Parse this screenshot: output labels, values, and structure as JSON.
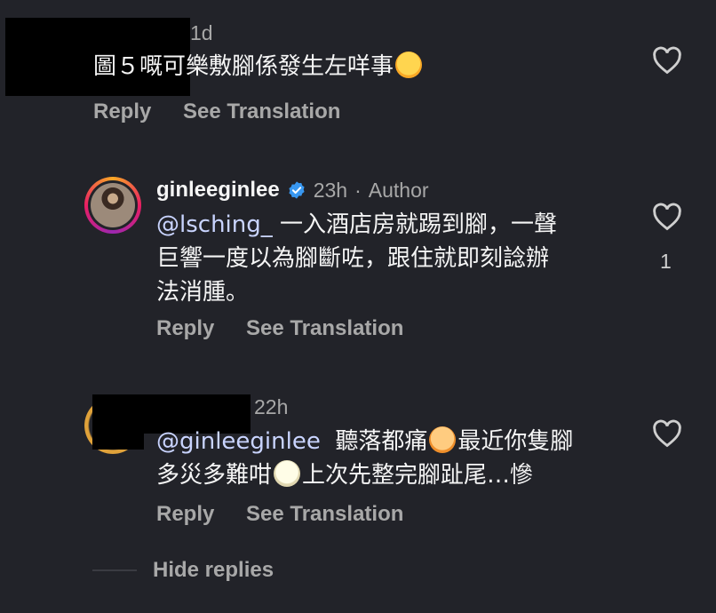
{
  "comments": [
    {
      "time": "1d",
      "text": "圖５嘅可樂敷腳係發生左咩事",
      "emoji": "face-with-tears-of-joy",
      "reply_label": "Reply",
      "translate_label": "See Translation"
    },
    {
      "username": "ginleeginlee",
      "verified": true,
      "time": "23h",
      "author_badge": "Author",
      "mention": "@lsching_",
      "line1": "一入酒店房就踢到腳，一聲",
      "line2": "巨響一度以為腳斷咗，跟住就即刻諗辦",
      "line3": "法消腫。",
      "likes": "1",
      "reply_label": "Reply",
      "translate_label": "See Translation"
    },
    {
      "time": "22h",
      "mention": "@ginleeginlee",
      "line1_a": "聽落都痛",
      "line1_b": "最近你隻腳",
      "line2_a": "多災多難咁",
      "line2_b": "上次先整完腳趾尾…慘",
      "emoji1": "face-screaming-in-fear",
      "emoji2": "cold-face",
      "reply_label": "Reply",
      "translate_label": "See Translation"
    }
  ],
  "hide_replies_label": "Hide replies",
  "separator": "·",
  "colors": {
    "background": "#222329",
    "secondary_text": "#a8a8a8",
    "verified": "#3897f0"
  }
}
